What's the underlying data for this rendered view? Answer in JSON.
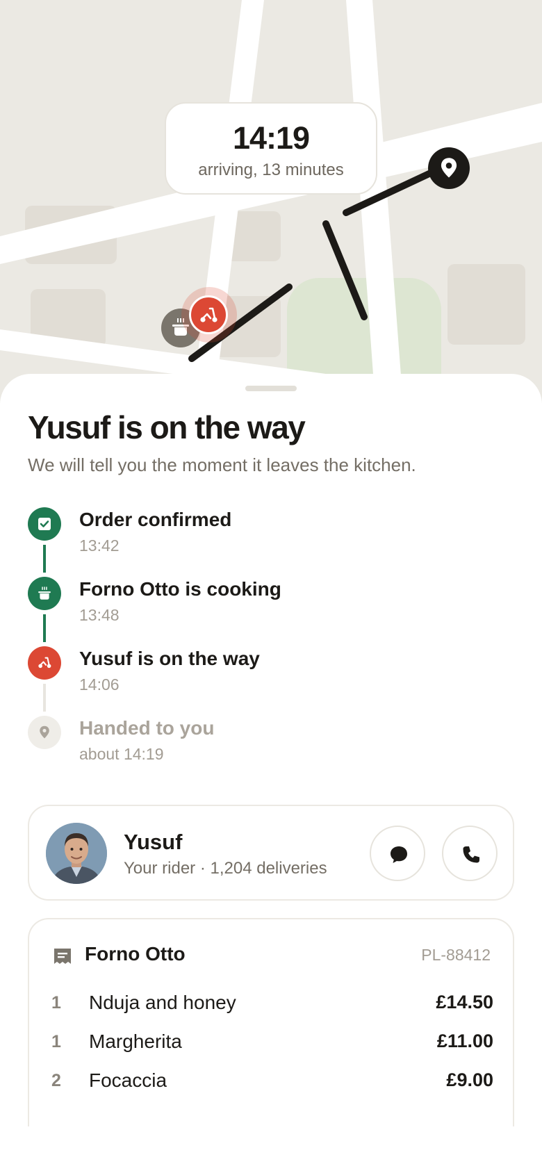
{
  "map": {
    "eta_time": "14:19",
    "eta_subtitle": "arriving, 13 minutes",
    "icons": {
      "destination": "map-pin-icon",
      "kitchen": "cooking-pot-icon",
      "rider": "scooter-icon"
    }
  },
  "sheet": {
    "title": "Yusuf is on the way",
    "subtitle": "We will tell you the moment it leaves the kitchen."
  },
  "timeline": [
    {
      "label": "Order confirmed",
      "time": "13:42",
      "state": "done",
      "icon": "check-icon"
    },
    {
      "label": "Forno Otto is cooking",
      "time": "13:48",
      "state": "done",
      "icon": "cooking-pot-icon"
    },
    {
      "label": "Yusuf is on the way",
      "time": "14:06",
      "state": "active",
      "icon": "scooter-icon"
    },
    {
      "label": "Handed to you",
      "time": "about 14:19",
      "state": "pending",
      "icon": "map-pin-icon"
    }
  ],
  "rider": {
    "name": "Yusuf",
    "meta": "Your rider · 1,204 deliveries",
    "actions": [
      "chat-icon",
      "phone-icon"
    ]
  },
  "order": {
    "restaurant": "Forno Otto",
    "order_id": "PL-88412",
    "items": [
      {
        "qty": "1",
        "name": "Nduja and honey",
        "price": "£14.50"
      },
      {
        "qty": "1",
        "name": "Margherita",
        "price": "£11.00"
      },
      {
        "qty": "2",
        "name": "Focaccia",
        "price": "£9.00"
      }
    ]
  },
  "colors": {
    "accent_green": "#1f7a52",
    "accent_red": "#dc4834",
    "map_background": "#ebe9e3",
    "park_green": "#dde6d2"
  }
}
